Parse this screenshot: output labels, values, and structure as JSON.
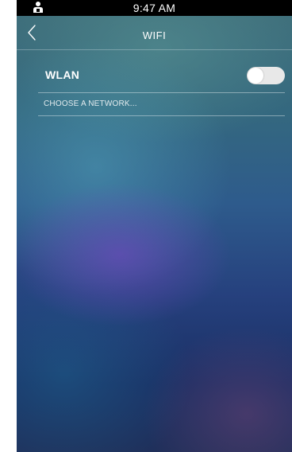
{
  "status_bar": {
    "time": "9:47 AM",
    "user_icon": "user-icon"
  },
  "header": {
    "title": "WIFI",
    "back_icon": "chevron-left-icon"
  },
  "wlan": {
    "label": "WLAN",
    "enabled": false
  },
  "network_section": {
    "label": "CHOOSE A NETWORK..."
  },
  "colors": {
    "status_bar_bg": "#000000",
    "text": "#ffffff",
    "toggle_track_off": "#e8e8e8"
  }
}
